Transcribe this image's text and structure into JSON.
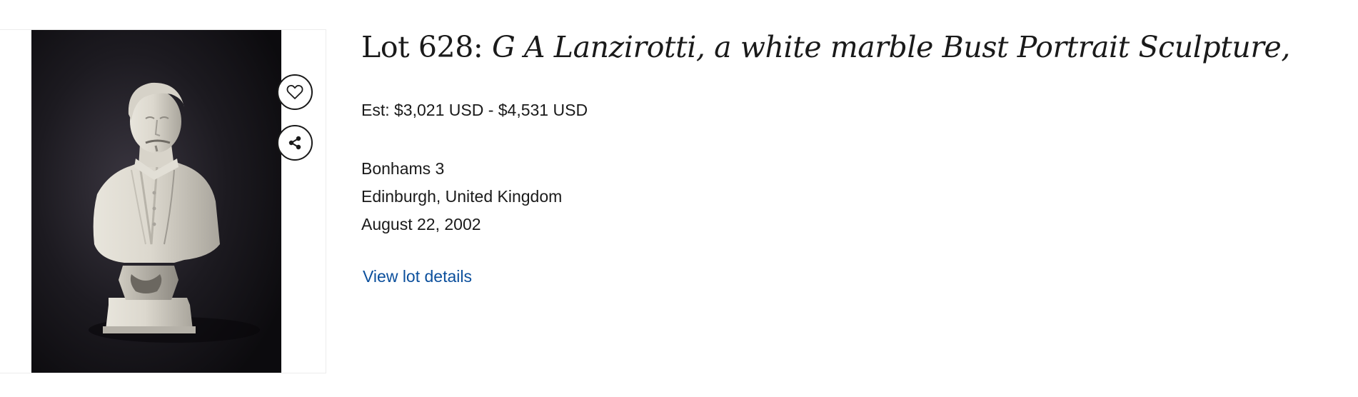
{
  "lot": {
    "number_label": "Lot 628:",
    "name": "G A Lanzirotti, a white marble Bust Portrait Sculpture,",
    "estimate": "Est: $3,021 USD - $4,531 USD",
    "auction_house": "Bonhams 3",
    "location": "Edinburgh, United Kingdom",
    "date": "August 22, 2002",
    "details_link": "View lot details"
  },
  "actions": {
    "favorite_icon": "heart-icon",
    "share_icon": "share-icon"
  },
  "image": {
    "subject": "white marble bust on dark background"
  },
  "colors": {
    "link": "#0b4f9c",
    "text": "#1a1a1a",
    "image_background": "#121015"
  }
}
